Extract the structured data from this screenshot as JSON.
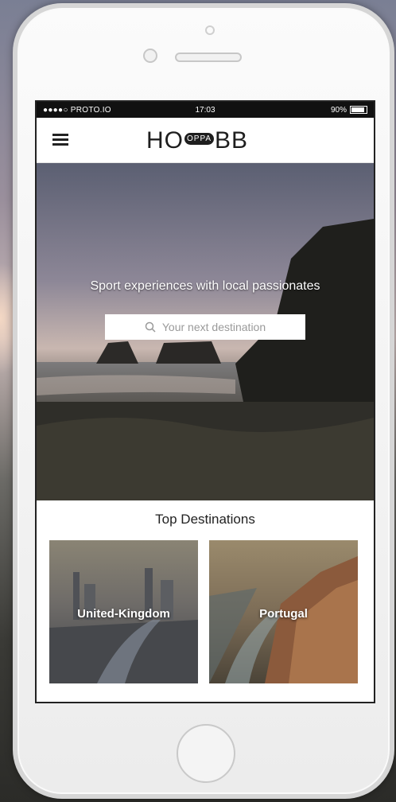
{
  "status_bar": {
    "carrier": "●●●●○ PROTO.IO",
    "time": "17:03",
    "battery": "90%",
    "battery_level": 0.9
  },
  "header": {
    "logo_left": "HO",
    "logo_mid": "OPPA",
    "logo_right": "BB"
  },
  "hero": {
    "tagline": "Sport experiences with local passionates",
    "search_placeholder": "Your next destination"
  },
  "destinations": {
    "title": "Top Destinations",
    "items": [
      {
        "label": "United-Kingdom"
      },
      {
        "label": "Portugal"
      }
    ]
  },
  "colors": {
    "status_bar": "#111111",
    "text": "#222222",
    "placeholder": "#9a9a9a"
  }
}
